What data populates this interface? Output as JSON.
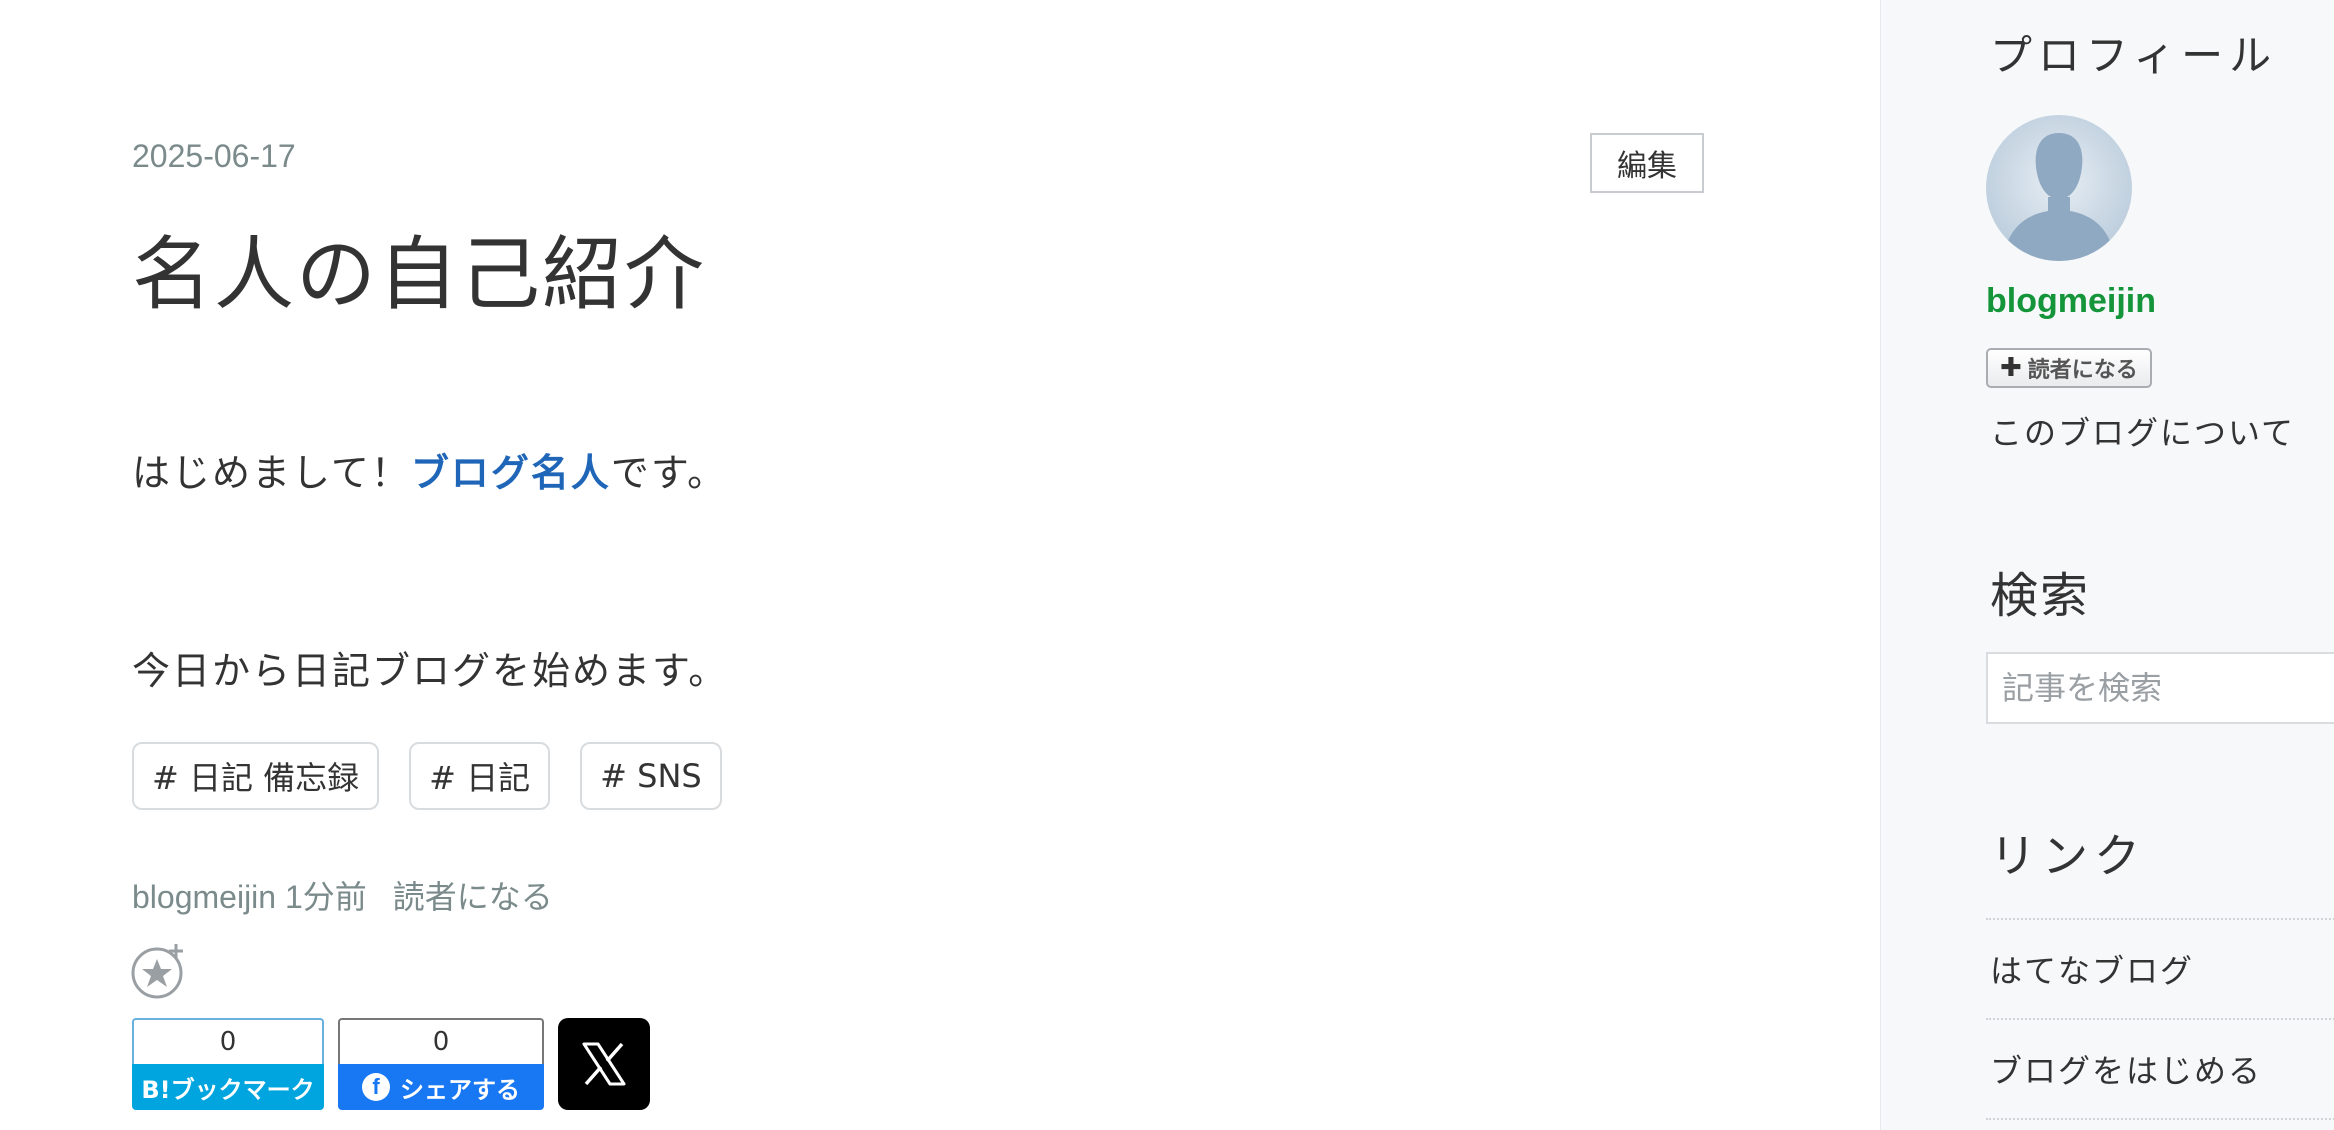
{
  "article": {
    "date": "2025-06-17",
    "edit_label": "編集",
    "title": "名人の自己紹介",
    "para1_prefix": "はじめまして！",
    "para1_link": "ブログ名人",
    "para1_suffix": "です。",
    "para2": "今日から日記ブログを始めます。",
    "tags": [
      "# 日記 備忘録",
      "# 日記",
      "# SNS"
    ],
    "meta_author": "blogmeijin",
    "meta_time": "1分前",
    "meta_subscribe": "読者になる"
  },
  "share": {
    "hatena_count": "0",
    "hatena_label": "B!ブックマーク",
    "facebook_count": "0",
    "facebook_label": "シェアする"
  },
  "sidebar": {
    "profile_heading": "プロフィール",
    "username": "blogmeijin",
    "subscribe_label": "読者になる",
    "about_link": "このブログについて",
    "search_heading": "検索",
    "search_placeholder": "記事を検索",
    "links_heading": "リンク",
    "links": [
      "はてなブログ",
      "ブログをはじめる"
    ]
  },
  "colors": {
    "link_blue": "#2066b8",
    "username_green": "#14953a",
    "hatena_blue": "#00a4de",
    "facebook_blue": "#1877f2"
  },
  "icons": [
    "add-star-icon",
    "facebook-icon",
    "x-logo-icon",
    "plus-icon",
    "avatar-silhouette-icon"
  ]
}
